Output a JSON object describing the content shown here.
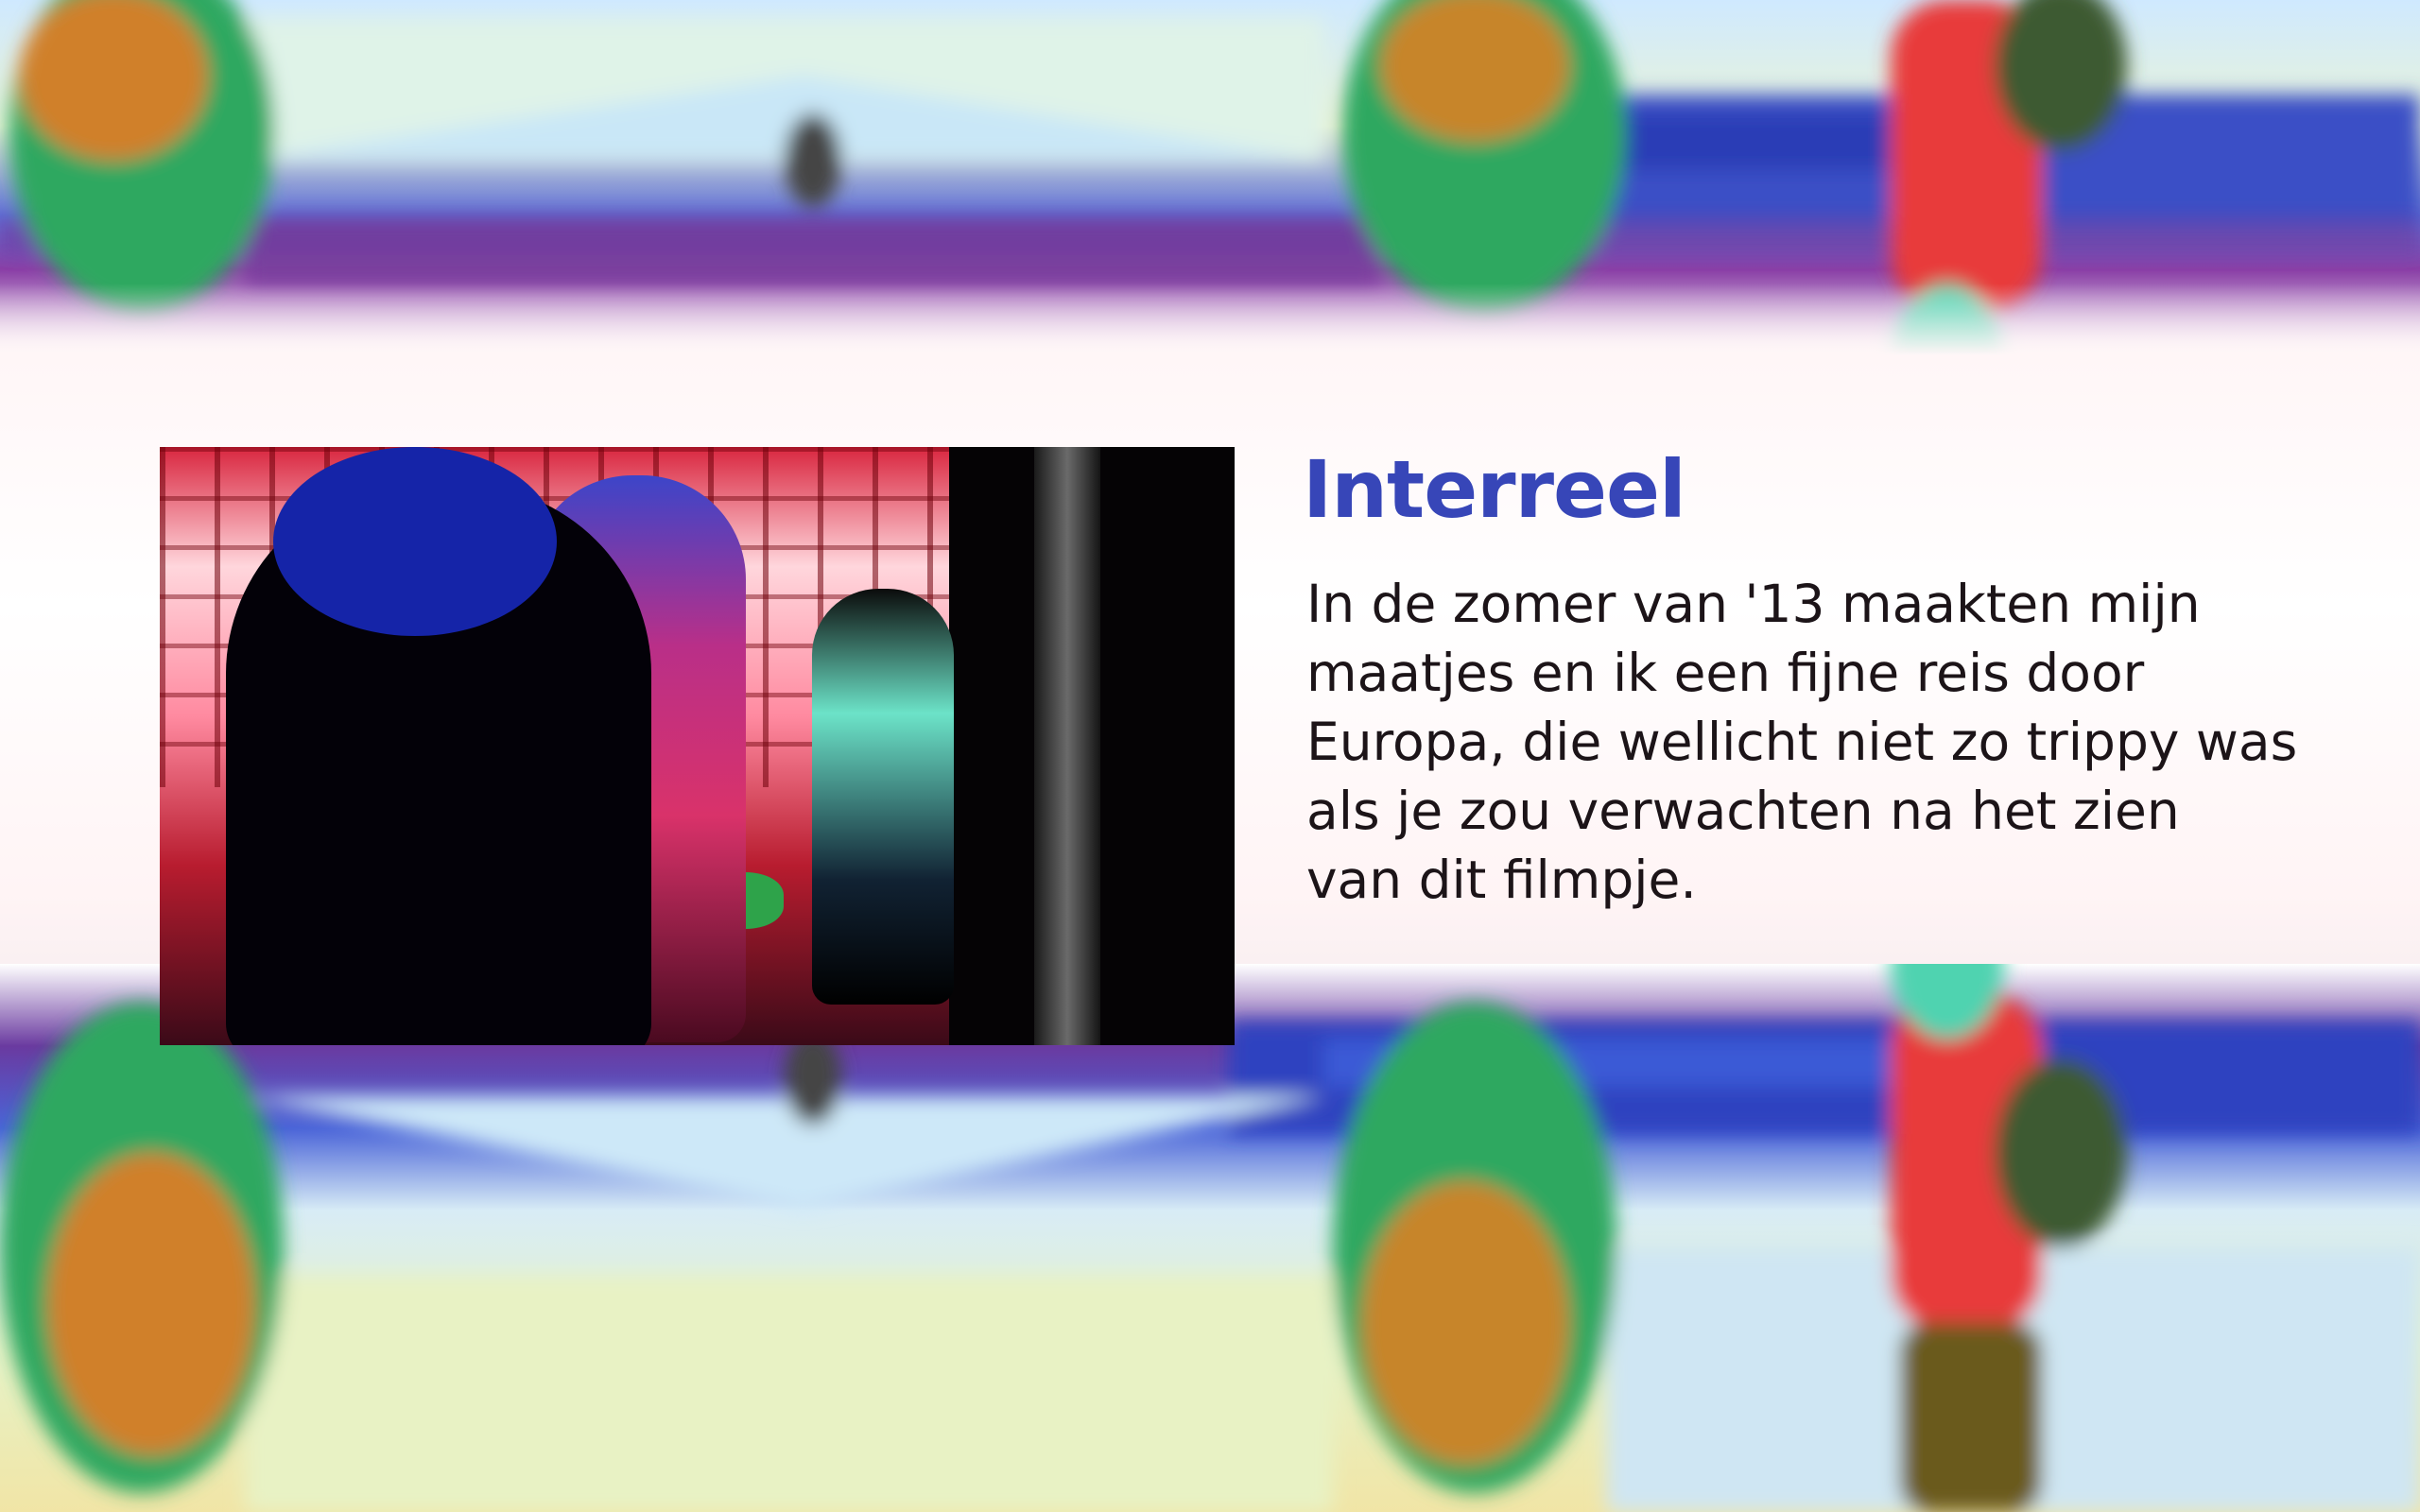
{
  "colors": {
    "heading": "#3746b8",
    "body_text": "#1c1418",
    "video_background": "#000000"
  },
  "background": {
    "description_icon": "psychedelic-mirrored-photo-background"
  },
  "video": {
    "icon": "video-thumbnail"
  },
  "content": {
    "title": "Interreel",
    "body_lines": [
      "In de zomer van '13 maakten mijn",
      "maatjes en ik een fijne reis door",
      "Europa, die wellicht niet zo trippy was",
      "als je zou verwachten na het zien",
      "van dit filmpje."
    ]
  }
}
